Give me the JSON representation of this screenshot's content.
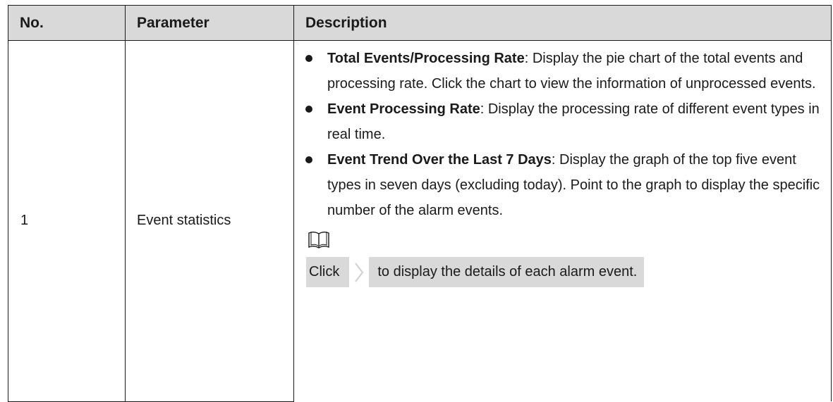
{
  "table": {
    "headers": [
      "No.",
      "Parameter",
      "Description"
    ],
    "row": {
      "no": "1",
      "parameter": "Event statistics",
      "bullets": [
        {
          "bold": "Total Events/Processing Rate",
          "text": ": Display the pie chart of the total events and processing rate. Click the chart to view the information of unprocessed events."
        },
        {
          "bold": "Event Processing Rate",
          "text": ": Display the processing rate of different event types in real time."
        },
        {
          "bold": "Event Trend Over the Last 7 Days",
          "text": ": Display the graph of the top five event types in seven days (excluding today). Point to the graph to display the specific number of the alarm events."
        }
      ],
      "note": {
        "icon": "book-icon",
        "before": "Click",
        "inline_icon": "chevron-right-icon",
        "after": "to display the details of each alarm event."
      }
    }
  }
}
